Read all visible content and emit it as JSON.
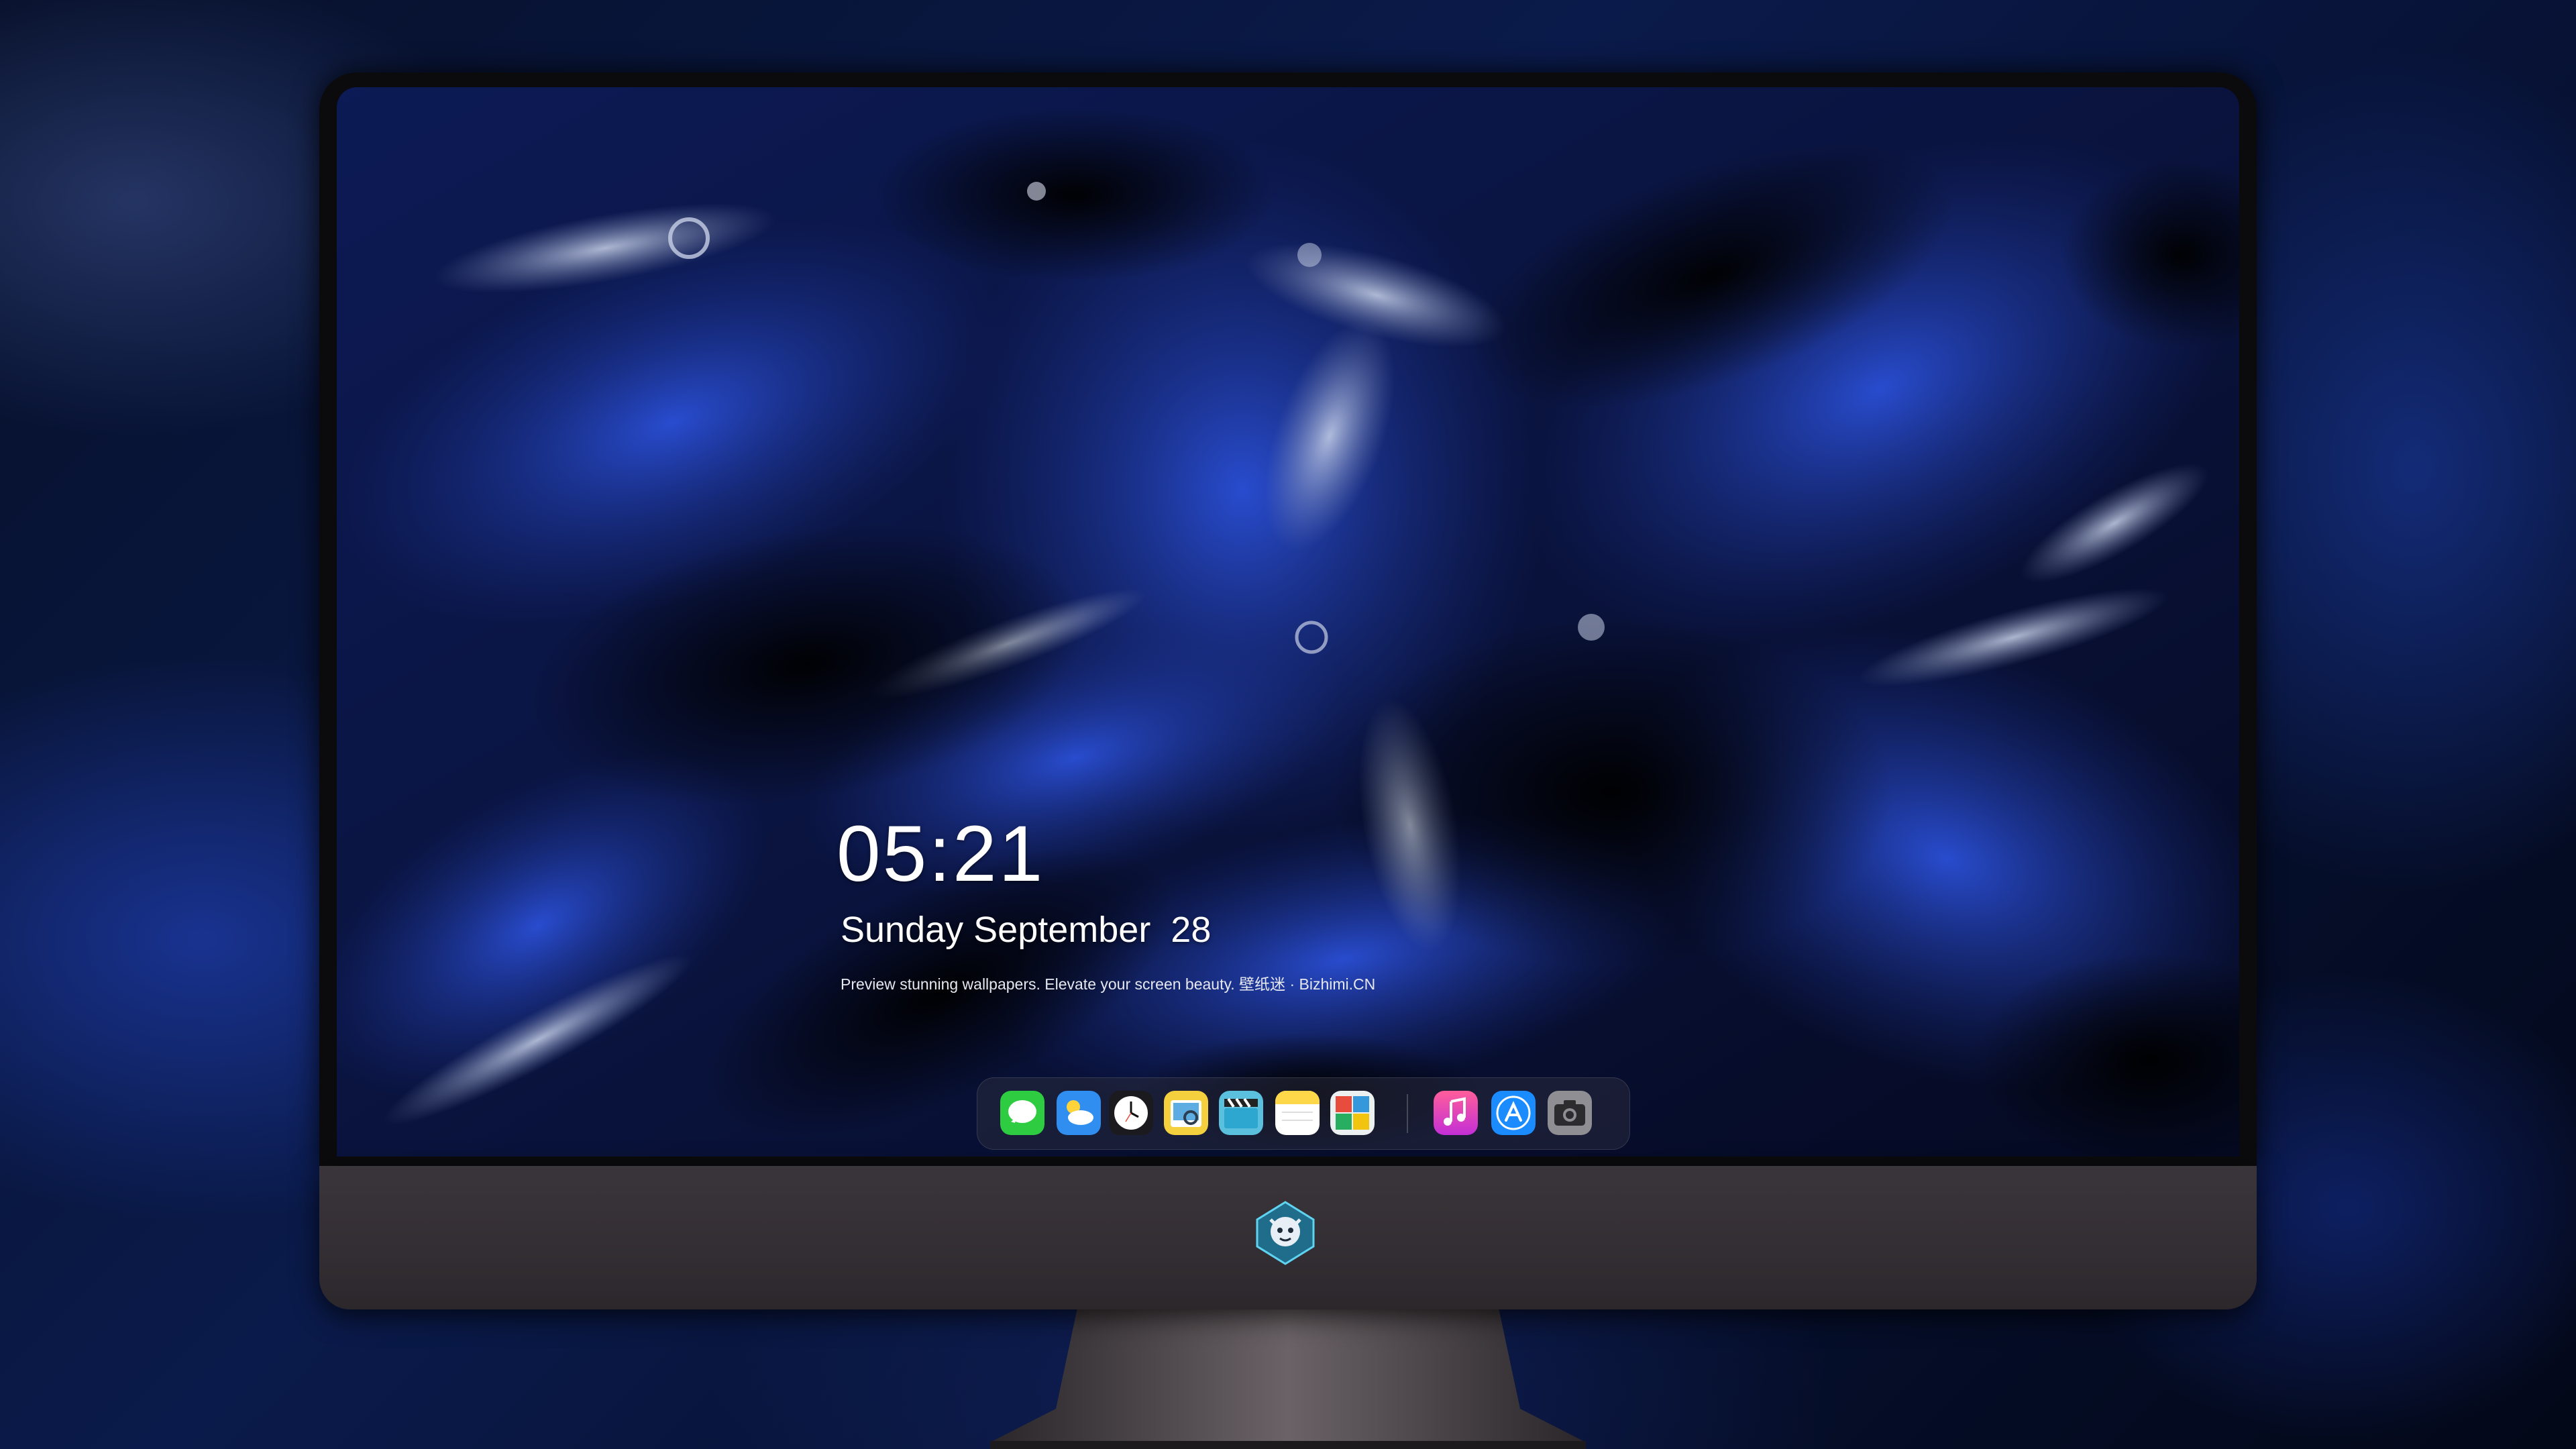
{
  "lock_screen": {
    "time": "05:21",
    "date": "Sunday September  28",
    "tagline": "Preview stunning wallpapers. Elevate your screen beauty. 壁纸迷 · Bizhimi.CN"
  },
  "dock": {
    "apps": [
      {
        "name": "messages-icon",
        "color": "#2ecc40"
      },
      {
        "name": "weather-icon",
        "color": "#2f8ef0"
      },
      {
        "name": "clock-icon",
        "color": "#ffffff"
      },
      {
        "name": "preview-icon",
        "color": "#f4d03f"
      },
      {
        "name": "clips-icon",
        "color": "#5bc0de"
      },
      {
        "name": "notes-icon",
        "color": "#ffd84a"
      },
      {
        "name": "photo-booth-icon",
        "color": "#e74c3c"
      },
      {
        "name": "music-icon",
        "color": "#ff2d78"
      },
      {
        "name": "app-store-icon",
        "color": "#1a8cff"
      },
      {
        "name": "camera-icon",
        "color": "#8e8e93"
      }
    ]
  },
  "colors": {
    "wallpaper_blue": "#1a3aa8",
    "wallpaper_dark": "#04081a",
    "chin": "#3a353a"
  }
}
